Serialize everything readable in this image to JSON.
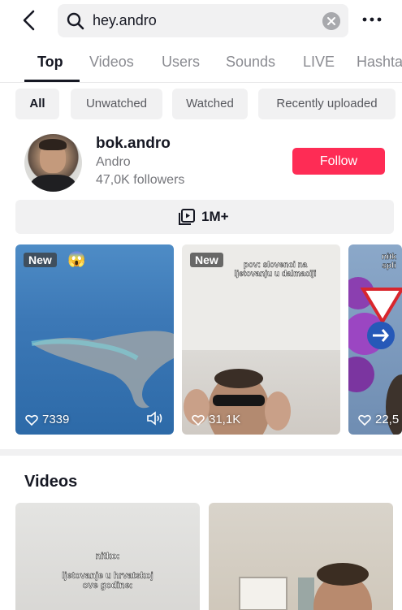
{
  "search": {
    "query": "hey.andro"
  },
  "tabs": [
    {
      "label": "Top"
    },
    {
      "label": "Videos"
    },
    {
      "label": "Users"
    },
    {
      "label": "Sounds"
    },
    {
      "label": "LIVE"
    },
    {
      "label": "Hashtags"
    }
  ],
  "filters": [
    {
      "label": "All"
    },
    {
      "label": "Unwatched"
    },
    {
      "label": "Watched"
    },
    {
      "label": "Recently uploaded"
    }
  ],
  "profile": {
    "username": "bok.andro",
    "nickname": "Andro",
    "followers": "47,0K followers",
    "follow_label": "Follow"
  },
  "video_count": "1M+",
  "top_videos": [
    {
      "badge": "New",
      "likes": "7339",
      "caption": ""
    },
    {
      "badge": "New",
      "likes": "31,1K",
      "caption_line1": "pov: slovenci na",
      "caption_line2": "ljetovanju u dalmaciji"
    },
    {
      "badge": "",
      "likes": "22,5",
      "caption_line1": "nitk",
      "caption_line2": "spli"
    }
  ],
  "videos_section": {
    "title": "Videos",
    "items": [
      {
        "caption_line1": "nitko:",
        "caption_line2": "ljetovanje u hrvatskoj",
        "caption_line3": "ove godine:"
      },
      {
        "caption_line1": ""
      }
    ]
  },
  "colors": {
    "accent": "#fe2c55",
    "chip_bg": "#f1f1f2",
    "text_primary": "#161823",
    "text_secondary": "#8a8b91"
  }
}
